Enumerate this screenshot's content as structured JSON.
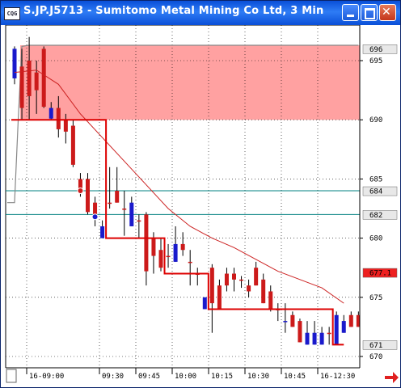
{
  "window": {
    "title": "S.JP.J5713 - Sumitomo Metal Mining Co Ltd, 3 Min",
    "icon_text": "CQG",
    "buttons": [
      "minimize-icon",
      "maximize-icon",
      "close-icon"
    ]
  },
  "chart_data": {
    "type": "candlestick",
    "ylim": [
      669,
      697
    ],
    "y_ticks": [
      670,
      675,
      680,
      685,
      690,
      695
    ],
    "x_ticks": [
      "16-09:00",
      "09:30",
      "09:45",
      "10:00",
      "10:15",
      "10:30",
      "10:45",
      "16-12:30"
    ],
    "colors": {
      "up": "#1a1acc",
      "down": "#cc1a1a",
      "trail": "#dd0000",
      "ma": "#cc2222",
      "band": "#ff9090",
      "grid": "#000000",
      "hline": "#008080"
    },
    "price_markers": [
      {
        "label": "696",
        "value": 696
      },
      {
        "label": "684",
        "value": 684
      },
      {
        "label": "682",
        "value": 682
      },
      {
        "label": "677.1",
        "value": 677.1
      },
      {
        "label": "671",
        "value": 671
      }
    ],
    "highlight_band": {
      "from": 690,
      "to": 696.3
    },
    "horizontal_lines": [
      684,
      682
    ],
    "candles": [
      {
        "o": 693.5,
        "h": 696.2,
        "l": 693,
        "c": 696,
        "color": "up"
      },
      {
        "o": 694.5,
        "h": 696,
        "l": 690,
        "c": 691,
        "color": "down"
      },
      {
        "o": 695,
        "h": 697,
        "l": 690,
        "c": 692,
        "color": "down"
      },
      {
        "o": 694,
        "h": 695,
        "l": 690.5,
        "c": 692.5,
        "color": "down"
      },
      {
        "o": 696,
        "h": 696.2,
        "l": 691,
        "c": 691.1,
        "color": "down"
      },
      {
        "o": 691,
        "h": 691.5,
        "l": 690,
        "c": 690.1,
        "color": "up"
      },
      {
        "o": 691,
        "h": 692,
        "l": 688.5,
        "c": 689.2,
        "color": "down"
      },
      {
        "o": 690,
        "h": 690.5,
        "l": 688,
        "c": 689,
        "color": "down"
      },
      {
        "o": 689.5,
        "h": 690,
        "l": 686,
        "c": 686.2,
        "color": "down"
      },
      {
        "o": 685,
        "h": 685.5,
        "l": 683.5,
        "c": 684,
        "color": "down"
      },
      {
        "o": 685,
        "h": 685.5,
        "l": 682,
        "c": 682.2,
        "color": "down"
      },
      {
        "o": 683,
        "h": 683.5,
        "l": 681,
        "c": 682,
        "color": "down"
      },
      {
        "o": 681,
        "h": 681.5,
        "l": 680,
        "c": 680,
        "color": "up"
      },
      {
        "o": 683,
        "h": 686,
        "l": 682.5,
        "c": 683,
        "color": "down"
      },
      {
        "o": 684,
        "h": 686,
        "l": 683,
        "c": 683,
        "color": "down"
      },
      {
        "o": 682.5,
        "h": 684,
        "l": 680.2,
        "c": 682.5,
        "color": "down"
      },
      {
        "o": 683,
        "h": 683.5,
        "l": 681,
        "c": 681,
        "color": "up"
      },
      {
        "o": 681.5,
        "h": 682,
        "l": 680,
        "c": 681.5,
        "color": "down"
      },
      {
        "o": 682,
        "h": 682.2,
        "l": 676,
        "c": 677.2,
        "color": "down"
      },
      {
        "o": 680,
        "h": 680.5,
        "l": 677,
        "c": 678.5,
        "color": "down"
      },
      {
        "o": 679,
        "h": 680,
        "l": 677.2,
        "c": 677.5,
        "color": "down"
      },
      {
        "o": 678.5,
        "h": 679.5,
        "l": 677.5,
        "c": 678.5,
        "color": "down"
      },
      {
        "o": 679.5,
        "h": 681,
        "l": 678,
        "c": 678,
        "color": "up"
      },
      {
        "o": 679,
        "h": 680.5,
        "l": 678.5,
        "c": 679.5,
        "color": "down"
      },
      {
        "o": 678,
        "h": 679,
        "l": 676,
        "c": 678,
        "color": "down"
      },
      {
        "o": 677,
        "h": 677.5,
        "l": 676,
        "c": 677,
        "color": "down"
      },
      {
        "o": 675,
        "h": 675,
        "l": 674,
        "c": 674,
        "color": "up"
      },
      {
        "o": 677.5,
        "h": 677.8,
        "l": 672,
        "c": 674.5,
        "color": "down"
      },
      {
        "o": 676,
        "h": 676.5,
        "l": 674,
        "c": 674,
        "color": "down"
      },
      {
        "o": 677,
        "h": 677.5,
        "l": 675.5,
        "c": 676,
        "color": "down"
      },
      {
        "o": 677,
        "h": 677.5,
        "l": 675.5,
        "c": 676.5,
        "color": "down"
      },
      {
        "o": 676.5,
        "h": 676.8,
        "l": 675.8,
        "c": 676.5,
        "color": "down"
      },
      {
        "o": 676,
        "h": 676.5,
        "l": 675,
        "c": 675.5,
        "color": "down"
      },
      {
        "o": 677.5,
        "h": 678,
        "l": 676,
        "c": 676,
        "color": "down"
      },
      {
        "o": 676.5,
        "h": 677,
        "l": 674.5,
        "c": 674.5,
        "color": "down"
      },
      {
        "o": 675.5,
        "h": 676,
        "l": 673.8,
        "c": 674,
        "color": "down"
      },
      {
        "o": 674,
        "h": 674.5,
        "l": 673,
        "c": 674,
        "color": "down"
      },
      {
        "o": 673,
        "h": 674.5,
        "l": 672,
        "c": 673,
        "color": "up"
      },
      {
        "o": 673.5,
        "h": 673.8,
        "l": 672.5,
        "c": 672.5,
        "color": "down"
      },
      {
        "o": 673,
        "h": 673.2,
        "l": 671.2,
        "c": 671.2,
        "color": "down"
      },
      {
        "o": 672,
        "h": 673,
        "l": 671,
        "c": 671,
        "color": "up"
      },
      {
        "o": 672,
        "h": 673,
        "l": 671,
        "c": 671,
        "color": "up"
      },
      {
        "o": 672,
        "h": 672.5,
        "l": 671,
        "c": 671,
        "color": "up"
      },
      {
        "o": 672,
        "h": 672.5,
        "l": 671,
        "c": 672,
        "color": "down"
      },
      {
        "o": 673.5,
        "h": 673.8,
        "l": 671,
        "c": 671,
        "color": "up"
      },
      {
        "o": 673,
        "h": 673.5,
        "l": 672,
        "c": 672,
        "color": "up"
      },
      {
        "o": 673.5,
        "h": 673.8,
        "l": 672.5,
        "c": 672.5,
        "color": "down"
      },
      {
        "o": 673.5,
        "h": 673.8,
        "l": 672.5,
        "c": 672.5,
        "color": "down"
      }
    ],
    "trail_stop": [
      [
        0,
        690
      ],
      [
        1,
        690
      ],
      [
        2,
        690
      ],
      [
        3,
        690
      ],
      [
        4,
        690
      ],
      [
        5,
        690
      ],
      [
        6,
        690
      ],
      [
        7,
        690
      ],
      [
        8,
        690
      ],
      [
        9,
        690
      ],
      [
        10,
        690
      ],
      [
        11,
        690
      ],
      [
        12,
        690
      ],
      [
        13,
        680
      ],
      [
        14,
        680
      ],
      [
        15,
        680
      ],
      [
        16,
        680
      ],
      [
        17,
        680
      ],
      [
        18,
        680
      ],
      [
        19,
        680
      ],
      [
        20,
        680
      ],
      [
        21,
        677
      ],
      [
        22,
        677
      ],
      [
        23,
        677
      ],
      [
        24,
        677
      ],
      [
        25,
        677
      ],
      [
        26,
        677
      ],
      [
        27,
        674
      ],
      [
        28,
        674
      ],
      [
        29,
        674
      ],
      [
        30,
        674
      ],
      [
        31,
        674
      ],
      [
        32,
        674
      ],
      [
        33,
        674
      ],
      [
        34,
        674
      ],
      [
        35,
        674
      ],
      [
        36,
        674
      ],
      [
        37,
        674
      ],
      [
        38,
        674
      ],
      [
        39,
        674
      ],
      [
        40,
        674
      ],
      [
        41,
        674
      ],
      [
        42,
        674
      ],
      [
        43,
        674
      ],
      [
        44,
        671
      ],
      [
        45,
        671
      ]
    ],
    "moving_average": [
      [
        0,
        694
      ],
      [
        3,
        694.2
      ],
      [
        6,
        693
      ],
      [
        9,
        690.5
      ],
      [
        12,
        688.5
      ],
      [
        15,
        686.5
      ],
      [
        18,
        684.5
      ],
      [
        21,
        682.5
      ],
      [
        24,
        681
      ],
      [
        27,
        680
      ],
      [
        30,
        679.2
      ],
      [
        33,
        678.2
      ],
      [
        36,
        677.2
      ],
      [
        39,
        676.5
      ],
      [
        42,
        675.8
      ],
      [
        45,
        674.5
      ]
    ],
    "thin_line_gray": [
      [
        -1,
        683
      ],
      [
        0,
        683
      ],
      [
        0.5,
        690
      ],
      [
        1,
        696.2
      ],
      [
        2,
        696.3
      ],
      [
        4,
        696.3
      ],
      [
        47,
        696.3
      ]
    ],
    "markers": [
      {
        "index": 9,
        "value": 684,
        "color": "#cc1a1a"
      },
      {
        "index": 11,
        "value": 681.8,
        "color": "#1a1acc"
      }
    ]
  }
}
